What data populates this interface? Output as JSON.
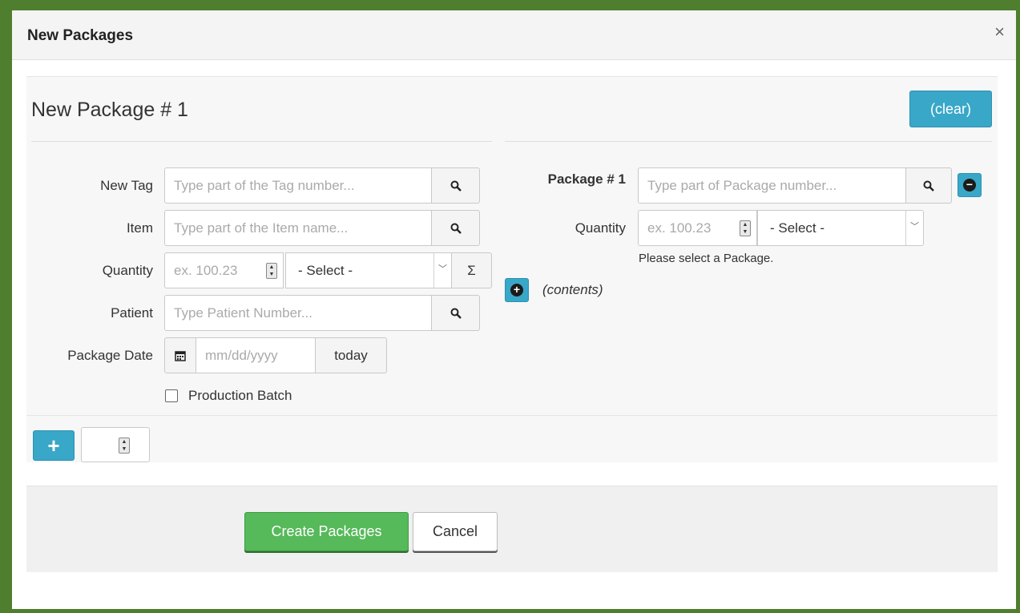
{
  "dialog": {
    "title": "New Packages",
    "close": "×"
  },
  "package": {
    "heading": "New Package # 1",
    "clear_label": "(clear)"
  },
  "left_form": {
    "new_tag": {
      "label": "New Tag",
      "placeholder": "Type part of the Tag number..."
    },
    "item": {
      "label": "Item",
      "placeholder": "Type part of the Item name..."
    },
    "quantity": {
      "label": "Quantity",
      "placeholder": "ex. 100.23",
      "unit_select": "- Select -",
      "sum_symbol": "Σ"
    },
    "patient": {
      "label": "Patient",
      "placeholder": "Type Patient Number..."
    },
    "package_date": {
      "label": "Package Date",
      "placeholder": "mm/dd/yyyy",
      "today_label": "today"
    },
    "production_batch": {
      "label": "Production Batch",
      "checked": false
    }
  },
  "right_form": {
    "package": {
      "label": "Package # 1",
      "placeholder": "Type part of Package number..."
    },
    "quantity": {
      "label": "Quantity",
      "placeholder": "ex. 100.23",
      "unit_select": "- Select -"
    },
    "hint": "Please select a Package.",
    "contents_label": "(contents)"
  },
  "add_row": {
    "plus_label": "+"
  },
  "footer": {
    "create_label": "Create Packages",
    "cancel_label": "Cancel"
  },
  "colors": {
    "border_green": "#4f7f2e",
    "info_blue": "#39a7c8",
    "success_green": "#56b95a"
  }
}
